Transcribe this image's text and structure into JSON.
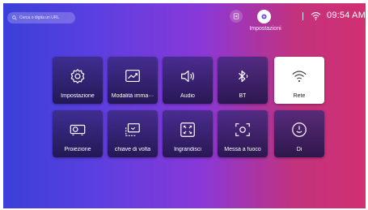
{
  "search": {
    "placeholder": "Cerca o digita un URL"
  },
  "status": {
    "settings_label": "Impostazioni",
    "time": "09:54 AM"
  },
  "tiles": [
    {
      "label": "Impostazione",
      "icon": "gear-icon"
    },
    {
      "label": "Modalità imma···",
      "icon": "image-mode-icon"
    },
    {
      "label": "Audio",
      "icon": "speaker-icon"
    },
    {
      "label": "BT",
      "icon": "bluetooth-icon"
    },
    {
      "label": "Rete",
      "icon": "wifi-icon",
      "selected": true
    },
    {
      "label": "Proiezione",
      "icon": "projector-icon"
    },
    {
      "label": "chiave di volta",
      "icon": "keystone-icon"
    },
    {
      "label": "Ingrandisci",
      "icon": "zoom-icon"
    },
    {
      "label": "Messa a fuoco",
      "icon": "focus-icon"
    },
    {
      "label": "Di",
      "icon": "power-icon"
    }
  ],
  "colors": {
    "bg_left": "#3a3fd9",
    "bg_right": "#d23070",
    "tile": "#2a1d5c",
    "selected": "#ffffff"
  }
}
